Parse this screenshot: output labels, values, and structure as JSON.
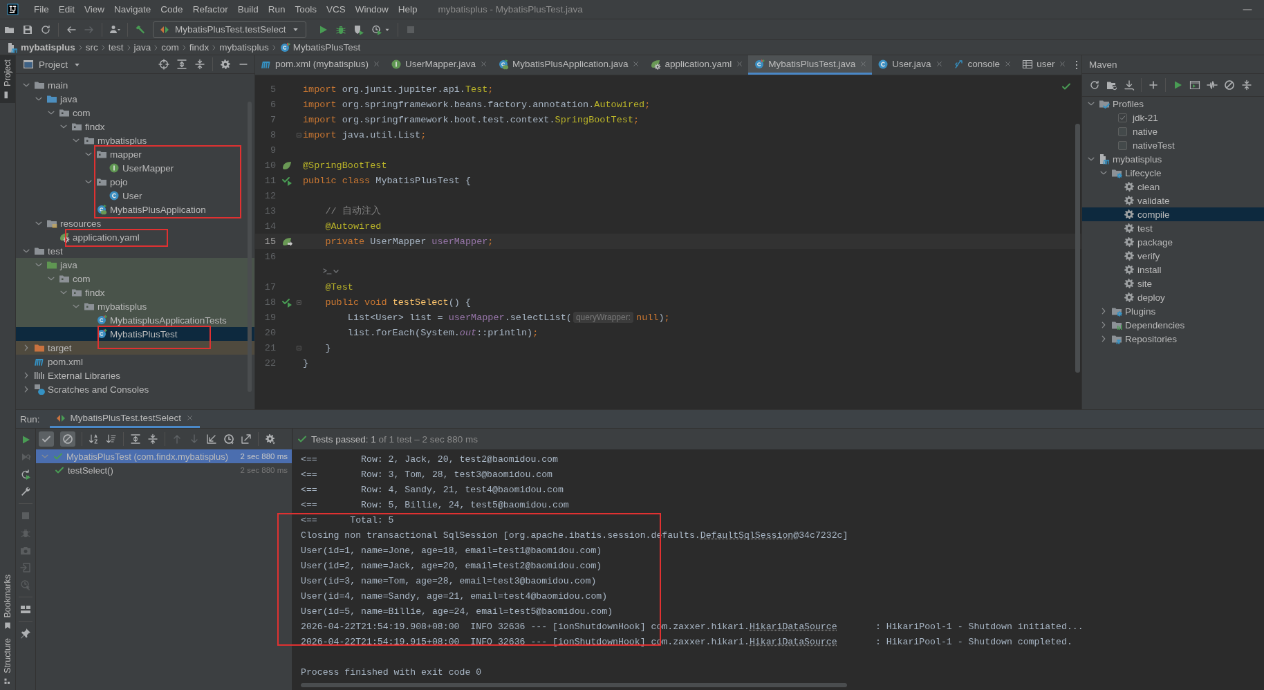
{
  "menu_bar": {
    "items": [
      "File",
      "Edit",
      "View",
      "Navigate",
      "Code",
      "Refactor",
      "Build",
      "Run",
      "Tools",
      "VCS",
      "Window",
      "Help"
    ],
    "title": "mybatisplus - MybatisPlusTest.java"
  },
  "toolbar": {
    "run_configuration": "MybatisPlusTest.testSelect"
  },
  "breadcrumbs": [
    {
      "label": "mybatisplus",
      "kind": "module"
    },
    {
      "label": "src",
      "kind": "dir"
    },
    {
      "label": "test",
      "kind": "dir"
    },
    {
      "label": "java",
      "kind": "dir"
    },
    {
      "label": "com",
      "kind": "dir"
    },
    {
      "label": "findx",
      "kind": "dir"
    },
    {
      "label": "mybatisplus",
      "kind": "dir"
    },
    {
      "label": "MybatisPlusTest",
      "kind": "test-class"
    }
  ],
  "tool_stripe": [
    {
      "label": "Project",
      "kind": "project",
      "selected": true
    },
    {
      "label": "Bookmarks",
      "kind": "bookmarks",
      "selected": false
    },
    {
      "label": "Structure",
      "kind": "structure",
      "selected": false
    }
  ],
  "project_panel": {
    "title": "Project",
    "tree": [
      {
        "label": "main",
        "kind": "folder",
        "expanded": true,
        "selected": false,
        "children": [
          {
            "label": "java",
            "kind": "source-folder",
            "expanded": true,
            "selected": false,
            "children": [
              {
                "label": "com",
                "kind": "package",
                "expanded": true,
                "selected": false,
                "children": [
                  {
                    "label": "findx",
                    "kind": "package",
                    "expanded": true,
                    "selected": false,
                    "children": [
                      {
                        "label": "mybatisplus",
                        "kind": "package",
                        "expanded": true,
                        "selected": false,
                        "children": [
                          {
                            "label": "mapper",
                            "kind": "package",
                            "expanded": true,
                            "selected": false,
                            "children": [
                              {
                                "label": "UserMapper",
                                "kind": "interface",
                                "selected": false
                              }
                            ]
                          },
                          {
                            "label": "pojo",
                            "kind": "package",
                            "expanded": true,
                            "selected": false,
                            "children": [
                              {
                                "label": "User",
                                "kind": "class",
                                "selected": false
                              }
                            ]
                          },
                          {
                            "label": "MybatisPlusApplication",
                            "kind": "spring-app",
                            "selected": false
                          }
                        ]
                      }
                    ]
                  }
                ]
              }
            ]
          },
          {
            "label": "resources",
            "kind": "resources-folder",
            "expanded": true,
            "selected": false,
            "children": [
              {
                "label": "application.yaml",
                "kind": "yaml",
                "selected": false
              }
            ]
          }
        ]
      },
      {
        "label": "test",
        "kind": "folder",
        "expanded": true,
        "selected": false,
        "children": [
          {
            "label": "java",
            "kind": "test-folder",
            "expanded": true,
            "selected": false,
            "test_source": true,
            "children": [
              {
                "label": "com",
                "kind": "package",
                "expanded": true,
                "selected": false,
                "test_source": true,
                "children": [
                  {
                    "label": "findx",
                    "kind": "package",
                    "expanded": true,
                    "selected": false,
                    "test_source": true,
                    "children": [
                      {
                        "label": "mybatisplus",
                        "kind": "package",
                        "expanded": true,
                        "selected": false,
                        "test_source": true,
                        "children": [
                          {
                            "label": "MybatisplusApplicationTests",
                            "kind": "test-class",
                            "selected": false,
                            "test_source": true
                          },
                          {
                            "label": "MybatisPlusTest",
                            "kind": "test-class",
                            "selected": true
                          }
                        ]
                      }
                    ]
                  }
                ]
              }
            ]
          }
        ]
      },
      {
        "label": "target",
        "kind": "excluded-folder",
        "expanded": false,
        "selected": false,
        "excluded": true
      },
      {
        "label": "pom.xml",
        "kind": "maven",
        "selected": false
      },
      {
        "label": "External Libraries",
        "kind": "libraries",
        "expanded": false,
        "selected": false
      },
      {
        "label": "Scratches and Consoles",
        "kind": "scratches",
        "expanded": false,
        "selected": false
      }
    ]
  },
  "editor": {
    "tabs": [
      {
        "label": "pom.xml (mybatisplus)",
        "kind": "maven",
        "selected": false
      },
      {
        "label": "UserMapper.java",
        "kind": "interface",
        "selected": false
      },
      {
        "label": "MybatisPlusApplication.java",
        "kind": "spring-app",
        "selected": false
      },
      {
        "label": "application.yaml",
        "kind": "yaml",
        "selected": false
      },
      {
        "label": "MybatisPlusTest.java",
        "kind": "test-class",
        "selected": true
      },
      {
        "label": "User.java",
        "kind": "class",
        "selected": false
      },
      {
        "label": "console",
        "kind": "db-console",
        "selected": false
      },
      {
        "label": "user",
        "kind": "table",
        "selected": false
      }
    ],
    "lines": [
      {
        "kind": "code",
        "number": "5",
        "current": false,
        "fold": false,
        "tokens": [
          {
            "kind": "kw",
            "text": "import"
          },
          {
            "kind": "plain",
            "text": " org.junit.jupiter.api."
          },
          {
            "kind": "ann",
            "text": "Test"
          },
          {
            "kind": "kw",
            "text": ";"
          }
        ]
      },
      {
        "kind": "code",
        "number": "6",
        "current": false,
        "fold": false,
        "tokens": [
          {
            "kind": "kw",
            "text": "import"
          },
          {
            "kind": "plain",
            "text": " org.springframework.beans.factory.annotation."
          },
          {
            "kind": "ann",
            "text": "Autowired"
          },
          {
            "kind": "kw",
            "text": ";"
          }
        ]
      },
      {
        "kind": "code",
        "number": "7",
        "current": false,
        "fold": false,
        "tokens": [
          {
            "kind": "kw",
            "text": "import"
          },
          {
            "kind": "plain",
            "text": " org.springframework.boot.test.context."
          },
          {
            "kind": "ann",
            "text": "SpringBootTest"
          },
          {
            "kind": "kw",
            "text": ";"
          }
        ]
      },
      {
        "kind": "code",
        "number": "8",
        "current": false,
        "fold": true,
        "tokens": [
          {
            "kind": "kw",
            "text": "import"
          },
          {
            "kind": "plain",
            "text": " java.util.List"
          },
          {
            "kind": "kw",
            "text": ";"
          }
        ]
      },
      {
        "kind": "code",
        "number": "9",
        "current": false,
        "fold": false
      },
      {
        "kind": "code",
        "number": "10",
        "current": false,
        "fold": false,
        "gutter": {
          "kind": "spring"
        },
        "tokens": [
          {
            "kind": "ann",
            "text": "@SpringBootTest"
          }
        ]
      },
      {
        "kind": "code",
        "number": "11",
        "current": false,
        "fold": false,
        "gutter": {
          "kind": "run"
        },
        "tokens": [
          {
            "kind": "kw",
            "text": "public class"
          },
          {
            "kind": "plain",
            "text": " MybatisPlusTest {"
          }
        ]
      },
      {
        "kind": "code",
        "number": "12",
        "current": false,
        "fold": false
      },
      {
        "kind": "code",
        "number": "13",
        "current": false,
        "fold": false,
        "tokens": [
          {
            "kind": "comment",
            "text": "    // 自动注入"
          }
        ]
      },
      {
        "kind": "code",
        "number": "14",
        "current": false,
        "fold": false,
        "tokens": [
          {
            "kind": "ann",
            "text": "    @Autowired"
          }
        ]
      },
      {
        "kind": "code",
        "number": "15",
        "current": true,
        "fold": false,
        "gutter": {
          "kind": "autowired"
        },
        "tokens": [
          {
            "kind": "kw",
            "text": "    private"
          },
          {
            "kind": "plain",
            "text": " UserMapper "
          },
          {
            "kind": "field",
            "text": "userMapper"
          },
          {
            "kind": "kw",
            "text": ";"
          }
        ]
      },
      {
        "kind": "code",
        "number": "16",
        "current": false,
        "fold": false
      },
      {
        "kind": "inlay"
      },
      {
        "kind": "code",
        "number": "17",
        "current": false,
        "fold": false,
        "tokens": [
          {
            "kind": "ann",
            "text": "    @Test"
          }
        ]
      },
      {
        "kind": "code",
        "number": "18",
        "current": false,
        "fold": true,
        "gutter": {
          "kind": "run"
        },
        "tokens": [
          {
            "kind": "kw",
            "text": "    public void"
          },
          {
            "kind": "method",
            "text": " testSelect"
          },
          {
            "kind": "plain",
            "text": "() {"
          }
        ]
      },
      {
        "kind": "code",
        "number": "19",
        "current": false,
        "fold": false,
        "tokens": [
          {
            "kind": "plain",
            "text": "        List<User> list = "
          },
          {
            "kind": "field",
            "text": "userMapper"
          },
          {
            "kind": "plain",
            "text": ".selectList("
          },
          {
            "kind": "hint",
            "text": "queryWrapper:"
          },
          {
            "kind": "kw",
            "text": "null"
          },
          {
            "kind": "plain",
            "text": ")"
          },
          {
            "kind": "kw",
            "text": ";"
          }
        ]
      },
      {
        "kind": "code",
        "number": "20",
        "current": false,
        "fold": false,
        "tokens": [
          {
            "kind": "plain",
            "text": "        list.forEach(System."
          },
          {
            "kind": "static",
            "text": "out"
          },
          {
            "kind": "plain",
            "text": "::println)"
          },
          {
            "kind": "kw",
            "text": ";"
          }
        ]
      },
      {
        "kind": "code",
        "number": "21",
        "current": false,
        "fold": true,
        "tokens": [
          {
            "kind": "plain",
            "text": "    }"
          }
        ]
      },
      {
        "kind": "code",
        "number": "22",
        "current": false,
        "fold": false,
        "tokens": [
          {
            "kind": "plain",
            "text": "}"
          }
        ]
      }
    ]
  },
  "maven_panel": {
    "title": "Maven",
    "tree": [
      {
        "label": "Profiles",
        "kind": "profiles",
        "expanded": true,
        "selected": false,
        "children": [
          {
            "label": "jdk-21",
            "kind": "profile",
            "checked": true,
            "selected": false
          },
          {
            "label": "native",
            "kind": "profile",
            "checked": false,
            "selected": false
          },
          {
            "label": "nativeTest",
            "kind": "profile",
            "checked": false,
            "selected": false
          }
        ]
      },
      {
        "label": "mybatisplus",
        "kind": "module",
        "expanded": true,
        "selected": false,
        "children": [
          {
            "label": "Lifecycle",
            "kind": "lifecycle",
            "expanded": true,
            "selected": false,
            "children": [
              {
                "label": "clean",
                "kind": "goal",
                "selected": false
              },
              {
                "label": "validate",
                "kind": "goal",
                "selected": false
              },
              {
                "label": "compile",
                "kind": "goal",
                "selected": true
              },
              {
                "label": "test",
                "kind": "goal",
                "selected": false
              },
              {
                "label": "package",
                "kind": "goal",
                "selected": false
              },
              {
                "label": "verify",
                "kind": "goal",
                "selected": false
              },
              {
                "label": "install",
                "kind": "goal",
                "selected": false
              },
              {
                "label": "site",
                "kind": "goal",
                "selected": false
              },
              {
                "label": "deploy",
                "kind": "goal",
                "selected": false
              }
            ]
          },
          {
            "label": "Plugins",
            "kind": "lifecycle",
            "expanded": false,
            "selected": false
          },
          {
            "label": "Dependencies",
            "kind": "dependencies",
            "expanded": false,
            "selected": false
          },
          {
            "label": "Repositories",
            "kind": "repositories",
            "expanded": false,
            "selected": false
          }
        ]
      }
    ]
  },
  "run_panel": {
    "label": "Run:",
    "tabs": [
      {
        "label": "MybatisPlusTest.testSelect",
        "selected": true
      }
    ],
    "status": {
      "passed": "Tests passed: 1",
      "detail": "of 1 test – 2 sec 880 ms"
    },
    "tests": [
      {
        "label": "MybatisPlusTest (com.findx.mybatisplus)",
        "time": "2 sec 880 ms",
        "selected": true,
        "children": [
          {
            "label": "testSelect()",
            "time": "2 sec 880 ms",
            "selected": false
          }
        ]
      }
    ],
    "console": [
      {
        "kind": "log",
        "segments": [
          {
            "kind": "text",
            "text": "<==        Row: 2, Jack, 20, test2@baomidou.com"
          }
        ]
      },
      {
        "kind": "log",
        "segments": [
          {
            "kind": "text",
            "text": "<==        Row: 3, Tom, 28, test3@baomidou.com"
          }
        ]
      },
      {
        "kind": "log",
        "segments": [
          {
            "kind": "text",
            "text": "<==        Row: 4, Sandy, 21, test4@baomidou.com"
          }
        ]
      },
      {
        "kind": "log",
        "segments": [
          {
            "kind": "text",
            "text": "<==        Row: 5, Billie, 24, test5@baomidou.com"
          }
        ]
      },
      {
        "kind": "log",
        "segments": [
          {
            "kind": "text",
            "text": "<==      Total: 5"
          }
        ]
      },
      {
        "kind": "log",
        "segments": [
          {
            "kind": "text",
            "text": "Closing non transactional SqlSession [org.apache.ibatis.session.defaults."
          },
          {
            "kind": "link",
            "text": "DefaultSqlSession"
          },
          {
            "kind": "text",
            "text": "@34c7232c]"
          }
        ]
      },
      {
        "kind": "log",
        "segments": [
          {
            "kind": "text",
            "text": "User(id=1, name=Jone, age=18, email=test1@baomidou.com)"
          }
        ]
      },
      {
        "kind": "log",
        "segments": [
          {
            "kind": "text",
            "text": "User(id=2, name=Jack, age=20, email=test2@baomidou.com)"
          }
        ]
      },
      {
        "kind": "log",
        "segments": [
          {
            "kind": "text",
            "text": "User(id=3, name=Tom, age=28, email=test3@baomidou.com)"
          }
        ]
      },
      {
        "kind": "log",
        "segments": [
          {
            "kind": "text",
            "text": "User(id=4, name=Sandy, age=21, email=test4@baomidou.com)"
          }
        ]
      },
      {
        "kind": "log",
        "segments": [
          {
            "kind": "text",
            "text": "User(id=5, name=Billie, age=24, email=test5@baomidou.com)"
          }
        ]
      },
      {
        "kind": "log",
        "segments": [
          {
            "kind": "text",
            "text": "2026-04-22T21:54:19.908+08:00  INFO 32636 --- [ionShutdownHook] com.zaxxer.hikari."
          },
          {
            "kind": "link",
            "text": "HikariDataSource"
          },
          {
            "kind": "text",
            "text": "       : HikariPool-1 - Shutdown initiated..."
          }
        ]
      },
      {
        "kind": "log",
        "segments": [
          {
            "kind": "text",
            "text": "2026-04-22T21:54:19.915+08:00  INFO 32636 --- [ionShutdownHook] com.zaxxer.hikari."
          },
          {
            "kind": "link",
            "text": "HikariDataSource"
          },
          {
            "kind": "text",
            "text": "       : HikariPool-1 - Shutdown completed."
          }
        ]
      },
      {
        "kind": "exit",
        "segments": [
          {
            "kind": "text",
            "text": "Process finished with exit code 0"
          }
        ]
      }
    ]
  }
}
